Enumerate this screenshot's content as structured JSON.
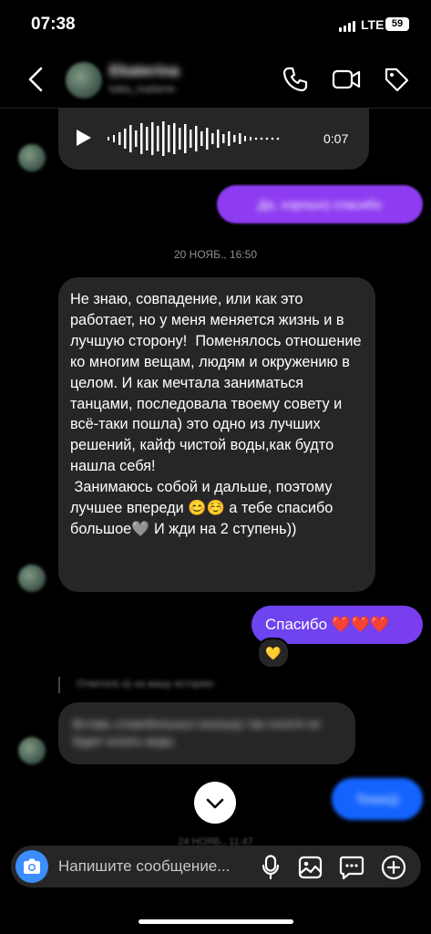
{
  "status_bar": {
    "time": "07:38",
    "network": "LTE",
    "battery": "59"
  },
  "header": {
    "name": "Ekaterina",
    "username": "katia_madame"
  },
  "messages": {
    "voice_duration": "0:07",
    "outgoing_reply_1": "Да, хорошо) спасибо",
    "timestamp_1": "20 НОЯБ., 16:50",
    "long_incoming": "Не знаю, совпадение, или как это работает, но у меня меняется жизнь и в лучшую сторону!  Поменялось отношение ко многим вещам, людям и окружению в целом. И как мечтала заниматься танцами, последовала твоему совету и всё-таки пошла) это одно из лучших решений, кайф чистой воды,как будто нашла себя!\n Занимаюсь собой и дальше, поэтому лучшее впереди 😊☺️ а тебе спасибо большое🩶 И жди на 2 ступень))",
    "outgoing_thanks": "Спасибо ❤️❤️❤️",
    "reaction": "💛",
    "story_reply_note": "Ответил(-а) на вашу историю",
    "blurred_incoming": "Вставь сло­во­бо­ль­ных-ско­ль­ку) так сосетя не будет искать воды",
    "blue_outgoing": "Точно))",
    "timestamp_2": "24 НОЯБ., 11:47"
  },
  "composer": {
    "placeholder": "Напишите сообщение..."
  },
  "colors": {
    "purple": "#8e3cf2",
    "violet": "#6b45f0",
    "blue": "#1463ff",
    "incoming": "#262626"
  }
}
